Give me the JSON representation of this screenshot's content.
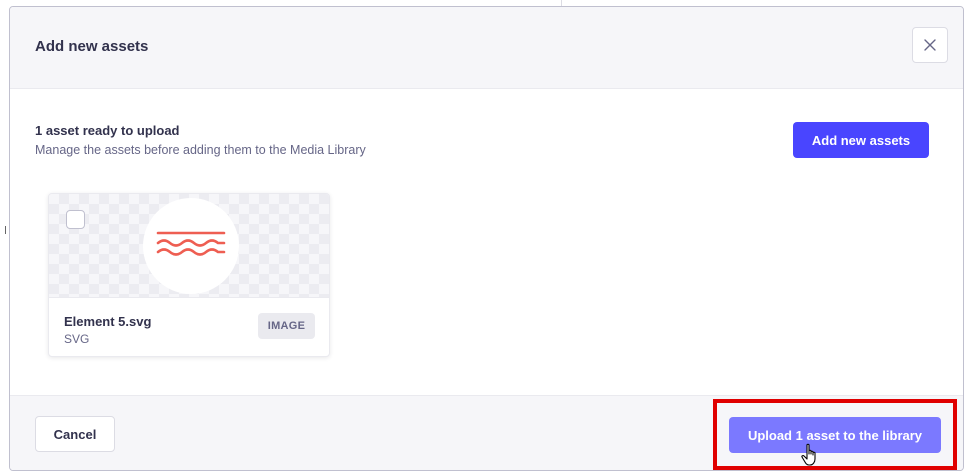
{
  "modal": {
    "title": "Add new assets",
    "close_icon": "close-icon"
  },
  "upload_summary": {
    "title": "1 asset ready to upload",
    "subtitle": "Manage the assets before adding them to the Media Library",
    "add_button_label": "Add new assets"
  },
  "asset_card": {
    "name": "Element 5.svg",
    "extension": "SVG",
    "type_badge": "IMAGE",
    "checked": false,
    "preview_icon": "wavy-lines-icon"
  },
  "footer": {
    "cancel_label": "Cancel",
    "upload_label": "Upload 1 asset to the library"
  },
  "colors": {
    "primary": "#4945ff",
    "primary_disabled": "#7b79ff",
    "highlight": "#e00000",
    "preview_lines": "#ee5e52"
  }
}
